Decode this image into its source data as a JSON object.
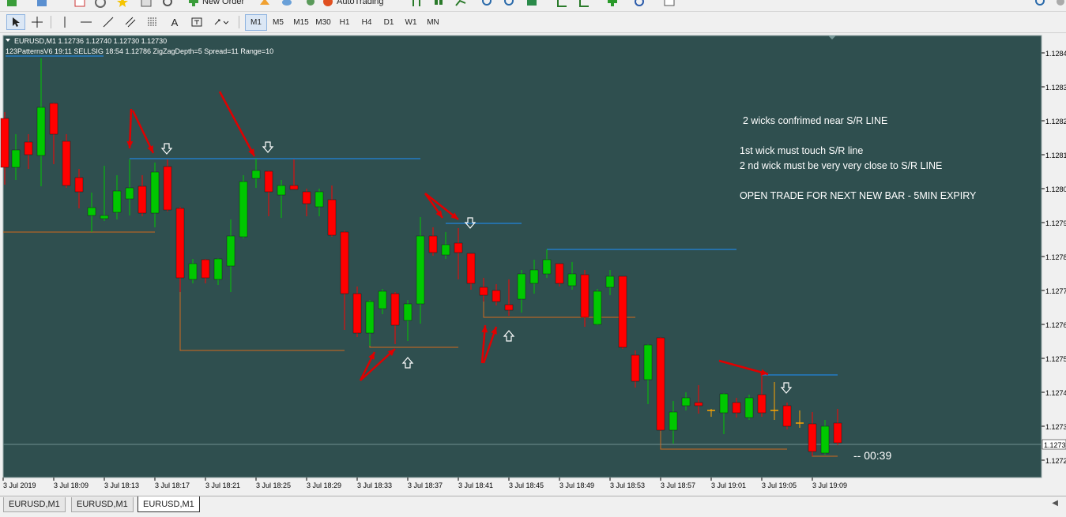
{
  "toolbar": {
    "new_order_label": "New Order",
    "autotrading_label": "AutoTrading",
    "timeframes": [
      "M1",
      "M5",
      "M15",
      "M30",
      "H1",
      "H4",
      "D1",
      "W1",
      "MN"
    ],
    "active_timeframe": "M1"
  },
  "chart": {
    "header_line1": "EURUSD,M1  1.12736 1.12740 1.12730 1.12730",
    "header_line2": "123PatternsV6  19:11  SELLSIG  18:54  1.12786  ZigZagDepth=5  Spread=11  Range=10",
    "price_labels": [
      "1.1284",
      "1.1283",
      "1.1282",
      "1.1281",
      "1.1280",
      "1.1279",
      "1.1278",
      "1.1277",
      "1.1276",
      "1.1275",
      "1.1274",
      "1.1273",
      "1.1272"
    ],
    "current_price_label": "1.1273",
    "time_labels": [
      "3 Jul 2019",
      "3 Jul 18:09",
      "3 Jul 18:13",
      "3 Jul 18:17",
      "3 Jul 18:21",
      "3 Jul 18:25",
      "3 Jul 18:29",
      "3 Jul 18:33",
      "3 Jul 18:37",
      "3 Jul 18:41",
      "3 Jul 18:45",
      "3 Jul 18:49",
      "3 Jul 18:53",
      "3 Jul 18:57",
      "3 Jul 19:01",
      "3 Jul 19:05",
      "3 Jul 19:09"
    ],
    "timer": "--  00:39",
    "notes": [
      "2 wicks confrimed near S/R LINE",
      "1st wick must touch S/R line",
      "2 nd wick must be very very close to S/R LINE",
      "OPEN TRADE FOR NEXT NEW BAR - 5MIN EXPIRY"
    ],
    "colors": {
      "background": "#2f4f4f",
      "bull": "#00c800",
      "bear": "#ff0000",
      "doji": "#ffa500",
      "resistance": "#1e90ff",
      "support": "#d2691e",
      "annotation": "#e00000",
      "axis_text": "#000000",
      "chart_text": "#ffffff"
    }
  },
  "tabs": [
    "EURUSD,M1",
    "EURUSD,M1",
    "EURUSD,M1"
  ],
  "active_tab": 2
}
